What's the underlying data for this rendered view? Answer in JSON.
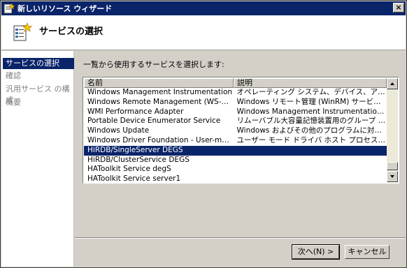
{
  "window": {
    "title": "新しいリソース ウィザード",
    "close_label": "×"
  },
  "header": {
    "title": "サービスの選択",
    "icon": "wizard-document-star-icon"
  },
  "sidebar": {
    "items": [
      {
        "label": "サービスの選択",
        "active": true
      },
      {
        "label": "確認",
        "active": false
      },
      {
        "label": "汎用サービス の構成",
        "active": false
      },
      {
        "label": "概要",
        "active": false
      }
    ]
  },
  "main": {
    "instruction": "一覧から使用するサービスを選択します:"
  },
  "service_list": {
    "columns": [
      "名前",
      "説明"
    ],
    "rows": [
      {
        "name": "Windows Management Instrumentation",
        "desc": "オペレーティング システム、デバイス、アプリケーショ…",
        "selected": false
      },
      {
        "name": "Windows Remote Management (WS-Managem…",
        "desc": "Windows リモート管理 (WinRM) サービスは、リモ…",
        "selected": false
      },
      {
        "name": "WMI Performance Adapter",
        "desc": "Windows Management Instrumentation (WMI) …",
        "selected": false
      },
      {
        "name": "Portable Device Enumerator Service",
        "desc": "リムーバブル大容量記憶装置用のグループ ポリシ…",
        "selected": false
      },
      {
        "name": "Windows Update",
        "desc": "Windows およびその他のプログラムに対する更新…",
        "selected": false
      },
      {
        "name": "Windows Driver Foundation - User-mode Driv…",
        "desc": "ユーザー モード ドライバ ホスト プロセスを管理し…",
        "selected": false
      },
      {
        "name": "HiRDB/SingleServer DEGS",
        "desc": "",
        "selected": true
      },
      {
        "name": "HiRDB/ClusterService DEGS",
        "desc": "",
        "selected": false
      },
      {
        "name": "HAToolkit Service degS",
        "desc": "",
        "selected": false
      },
      {
        "name": "HAToolkit Service server1",
        "desc": "",
        "selected": false
      }
    ]
  },
  "buttons": {
    "next_label": "次へ(N) >",
    "cancel_label": "キャンセル"
  }
}
